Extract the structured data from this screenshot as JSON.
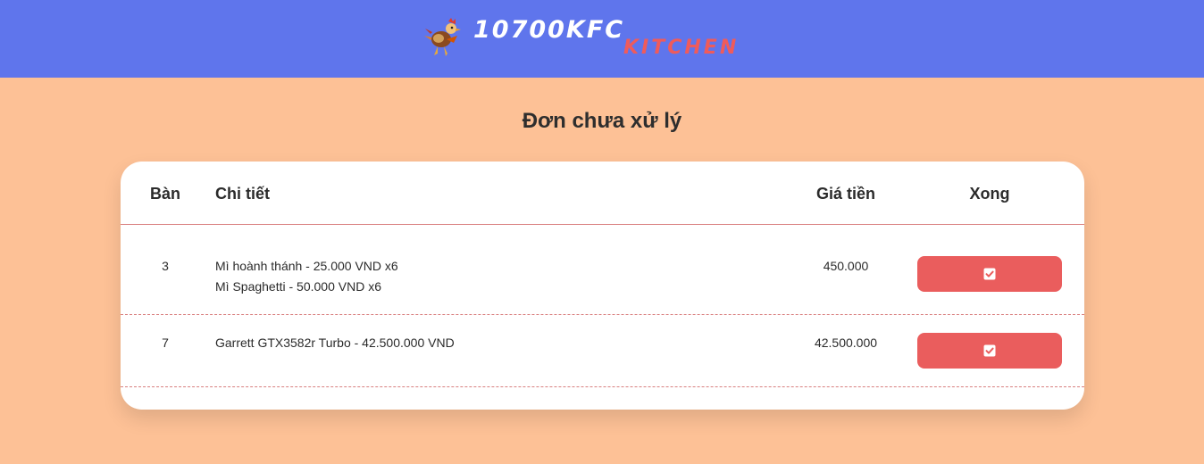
{
  "header": {
    "logo_top": "10700KFC",
    "logo_bottom": "KITCHEN",
    "mascot_icon": "rooster-mascot-icon",
    "background": "#5f75ec"
  },
  "page": {
    "title": "Đơn chưa xử lý",
    "background": "#fdc196"
  },
  "table": {
    "columns": [
      "Bàn",
      "Chi tiết",
      "Giá tiền",
      "Xong"
    ],
    "rows": [
      {
        "table_no": "3",
        "items": [
          "Mì hoành thánh - 25.000 VND x6",
          "Mì Spaghetti - 50.000 VND x6"
        ],
        "price": "450.000",
        "done_icon": "check-square-icon"
      },
      {
        "table_no": "7",
        "items": [
          "Garrett GTX3582r Turbo - 42.500.000 VND"
        ],
        "price": "42.500.000",
        "done_icon": "check-square-icon"
      }
    ]
  },
  "colors": {
    "accent": "#ea5d5d",
    "divider": "#d98080"
  }
}
